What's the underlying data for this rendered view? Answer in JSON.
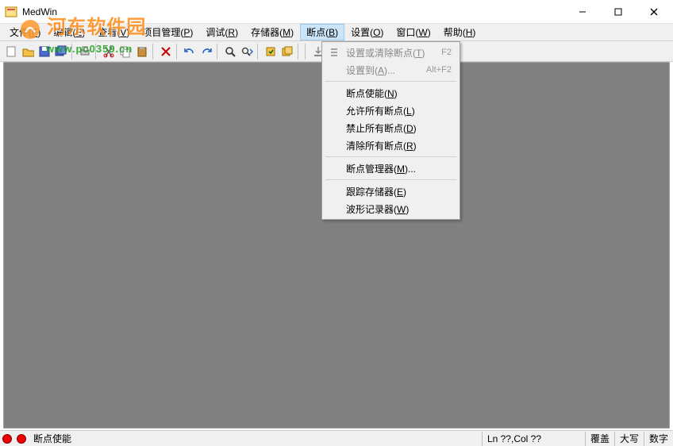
{
  "title": "MedWin",
  "watermark": {
    "text": "河东软件园",
    "url": "www.pc0359.cn"
  },
  "menubar": [
    {
      "label": "文件",
      "key": "F"
    },
    {
      "label": "编辑",
      "key": "E"
    },
    {
      "label": "查看",
      "key": "V"
    },
    {
      "label": "项目管理",
      "key": "P"
    },
    {
      "label": "调试",
      "key": "R"
    },
    {
      "label": "存储器",
      "key": "M"
    },
    {
      "label": "断点",
      "key": "B",
      "active": true
    },
    {
      "label": "设置",
      "key": "O"
    },
    {
      "label": "窗口",
      "key": "W"
    },
    {
      "label": "帮助",
      "key": "H"
    }
  ],
  "dropdown": {
    "groups": [
      [
        {
          "label": "设置或清除断点",
          "key": "T",
          "accel": "F2",
          "disabled": true,
          "icon": "breakpoint-toggle"
        },
        {
          "label": "设置到",
          "key": "A",
          "suffix": "...",
          "accel": "Alt+F2",
          "disabled": true
        }
      ],
      [
        {
          "label": "断点使能",
          "key": "N"
        },
        {
          "label": "允许所有断点",
          "key": "L"
        },
        {
          "label": "禁止所有断点",
          "key": "D"
        },
        {
          "label": "清除所有断点",
          "key": "R"
        }
      ],
      [
        {
          "label": "断点管理器",
          "key": "M",
          "suffix": "..."
        }
      ],
      [
        {
          "label": "跟踪存储器",
          "key": "E"
        },
        {
          "label": "波形记录器",
          "key": "W"
        }
      ]
    ]
  },
  "statusbar": {
    "message": "断点使能",
    "position": "Ln ??,Col ??",
    "indicators": [
      "覆盖",
      "大写",
      "数字"
    ]
  },
  "toolbar_icons": [
    "new-file",
    "open-file",
    "save-file",
    "save-all",
    "sep",
    "print",
    "sep",
    "cut",
    "copy",
    "paste",
    "sep",
    "delete",
    "sep",
    "undo",
    "redo",
    "sep",
    "find",
    "find-next",
    "sep",
    "build",
    "rebuild",
    "sep",
    "sep2",
    "step-into"
  ]
}
